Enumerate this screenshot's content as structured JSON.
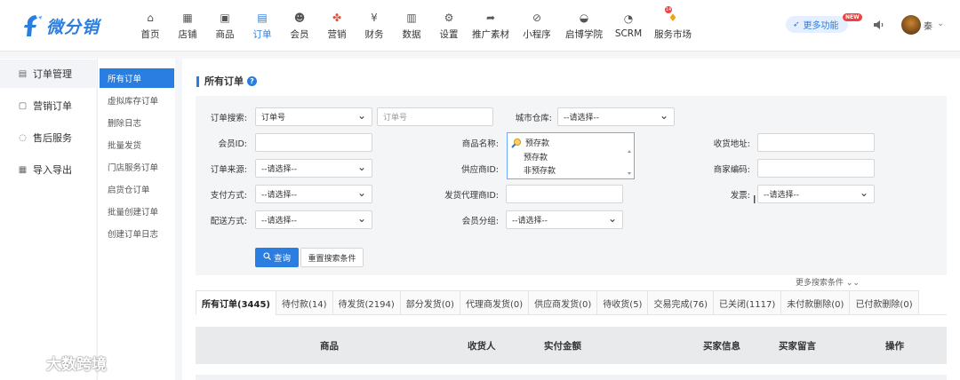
{
  "brand": {
    "name": "微分销",
    "color": "#2a7de1"
  },
  "nav": {
    "items": [
      {
        "label": "首页",
        "icon": "home-icon",
        "glyph": "⌂"
      },
      {
        "label": "店铺",
        "icon": "shop-icon",
        "glyph": "▦"
      },
      {
        "label": "商品",
        "icon": "goods-icon",
        "glyph": "▣"
      },
      {
        "label": "订单",
        "icon": "order-icon",
        "glyph": "▤",
        "active": true
      },
      {
        "label": "会员",
        "icon": "member-icon",
        "glyph": "☻"
      },
      {
        "label": "营销",
        "icon": "marketing-icon",
        "glyph": "✤"
      },
      {
        "label": "财务",
        "icon": "finance-icon",
        "glyph": "¥"
      },
      {
        "label": "数据",
        "icon": "data-icon",
        "glyph": "▥"
      },
      {
        "label": "设置",
        "icon": "settings-icon",
        "glyph": "⚙"
      },
      {
        "label": "推广素材",
        "icon": "share-icon",
        "glyph": "➦"
      },
      {
        "label": "小程序",
        "icon": "miniprogram-icon",
        "glyph": "⊘"
      },
      {
        "label": "启博学院",
        "icon": "academy-icon",
        "glyph": "◒"
      },
      {
        "label": "SCRM",
        "icon": "scrm-icon",
        "glyph": "◔"
      },
      {
        "label": "服务市场",
        "icon": "market-icon",
        "glyph": "♦",
        "badge": "14"
      }
    ],
    "more_features": "更多功能",
    "new_badge": "NEW",
    "user_name": "秦",
    "caret": "⌄"
  },
  "sidebar": {
    "items": [
      {
        "label": "订单管理",
        "icon": "order-manage-icon",
        "glyph": "▤",
        "active": true
      },
      {
        "label": "营销订单",
        "icon": "marketing-order-icon",
        "glyph": "▢"
      },
      {
        "label": "售后服务",
        "icon": "after-sales-icon",
        "glyph": "◌"
      },
      {
        "label": "导入导出",
        "icon": "import-export-icon",
        "glyph": "▦"
      }
    ]
  },
  "subnav": {
    "items": [
      {
        "label": "所有订单",
        "active": true
      },
      {
        "label": "虚拟库存订单"
      },
      {
        "label": "删除日志"
      },
      {
        "label": "批量发货"
      },
      {
        "label": "门店服务订单"
      },
      {
        "label": "启货仓订单"
      },
      {
        "label": "批量创建订单"
      },
      {
        "label": "创建订单日志"
      }
    ]
  },
  "page": {
    "title": "所有订单",
    "help": "?"
  },
  "filters": {
    "order_search_label": "订单搜索:",
    "order_search_type": "订单号",
    "order_search_placeholder": "订单号",
    "city_warehouse_label": "城市仓库:",
    "city_warehouse_value": "--请选择--",
    "member_id_label": "会员ID:",
    "product_name_label": "商品名称:",
    "product_name_search": "预存款",
    "product_options": [
      "预存款",
      "非预存款"
    ],
    "shipping_address_label": "收货地址:",
    "order_source_label": "订单来源:",
    "order_source_value": "--请选择--",
    "supplier_id_label": "供应商ID:",
    "merchant_code_label": "商家编码:",
    "payment_method_label": "支付方式:",
    "payment_method_value": "--请选择--",
    "agent_id_label": "发货代理商ID:",
    "invoice_label": "发票:",
    "invoice_value": "--请选择--",
    "delivery_method_label": "配送方式:",
    "delivery_method_value": "--请选择--",
    "member_group_label": "会员分组:",
    "member_group_value": "--请选择--",
    "query_button": "查询",
    "reset_button": "重置搜索条件",
    "more_filters": "更多搜索条件 ⌄⌄"
  },
  "tabs": [
    {
      "label": "所有订单(3445)",
      "active": true
    },
    {
      "label": "待付款(14)"
    },
    {
      "label": "待发货(2194)"
    },
    {
      "label": "部分发货(0)"
    },
    {
      "label": "代理商发货(0)"
    },
    {
      "label": "供应商发货(0)"
    },
    {
      "label": "待收货(5)"
    },
    {
      "label": "交易完成(76)"
    },
    {
      "label": "已关闭(1117)"
    },
    {
      "label": "未付款删除(0)"
    },
    {
      "label": "已付款删除(0)"
    }
  ],
  "table": {
    "columns": [
      "商品",
      "收货人",
      "实付金额",
      "买家信息",
      "买家留言",
      "操作"
    ]
  },
  "watermark": "大数跨境"
}
